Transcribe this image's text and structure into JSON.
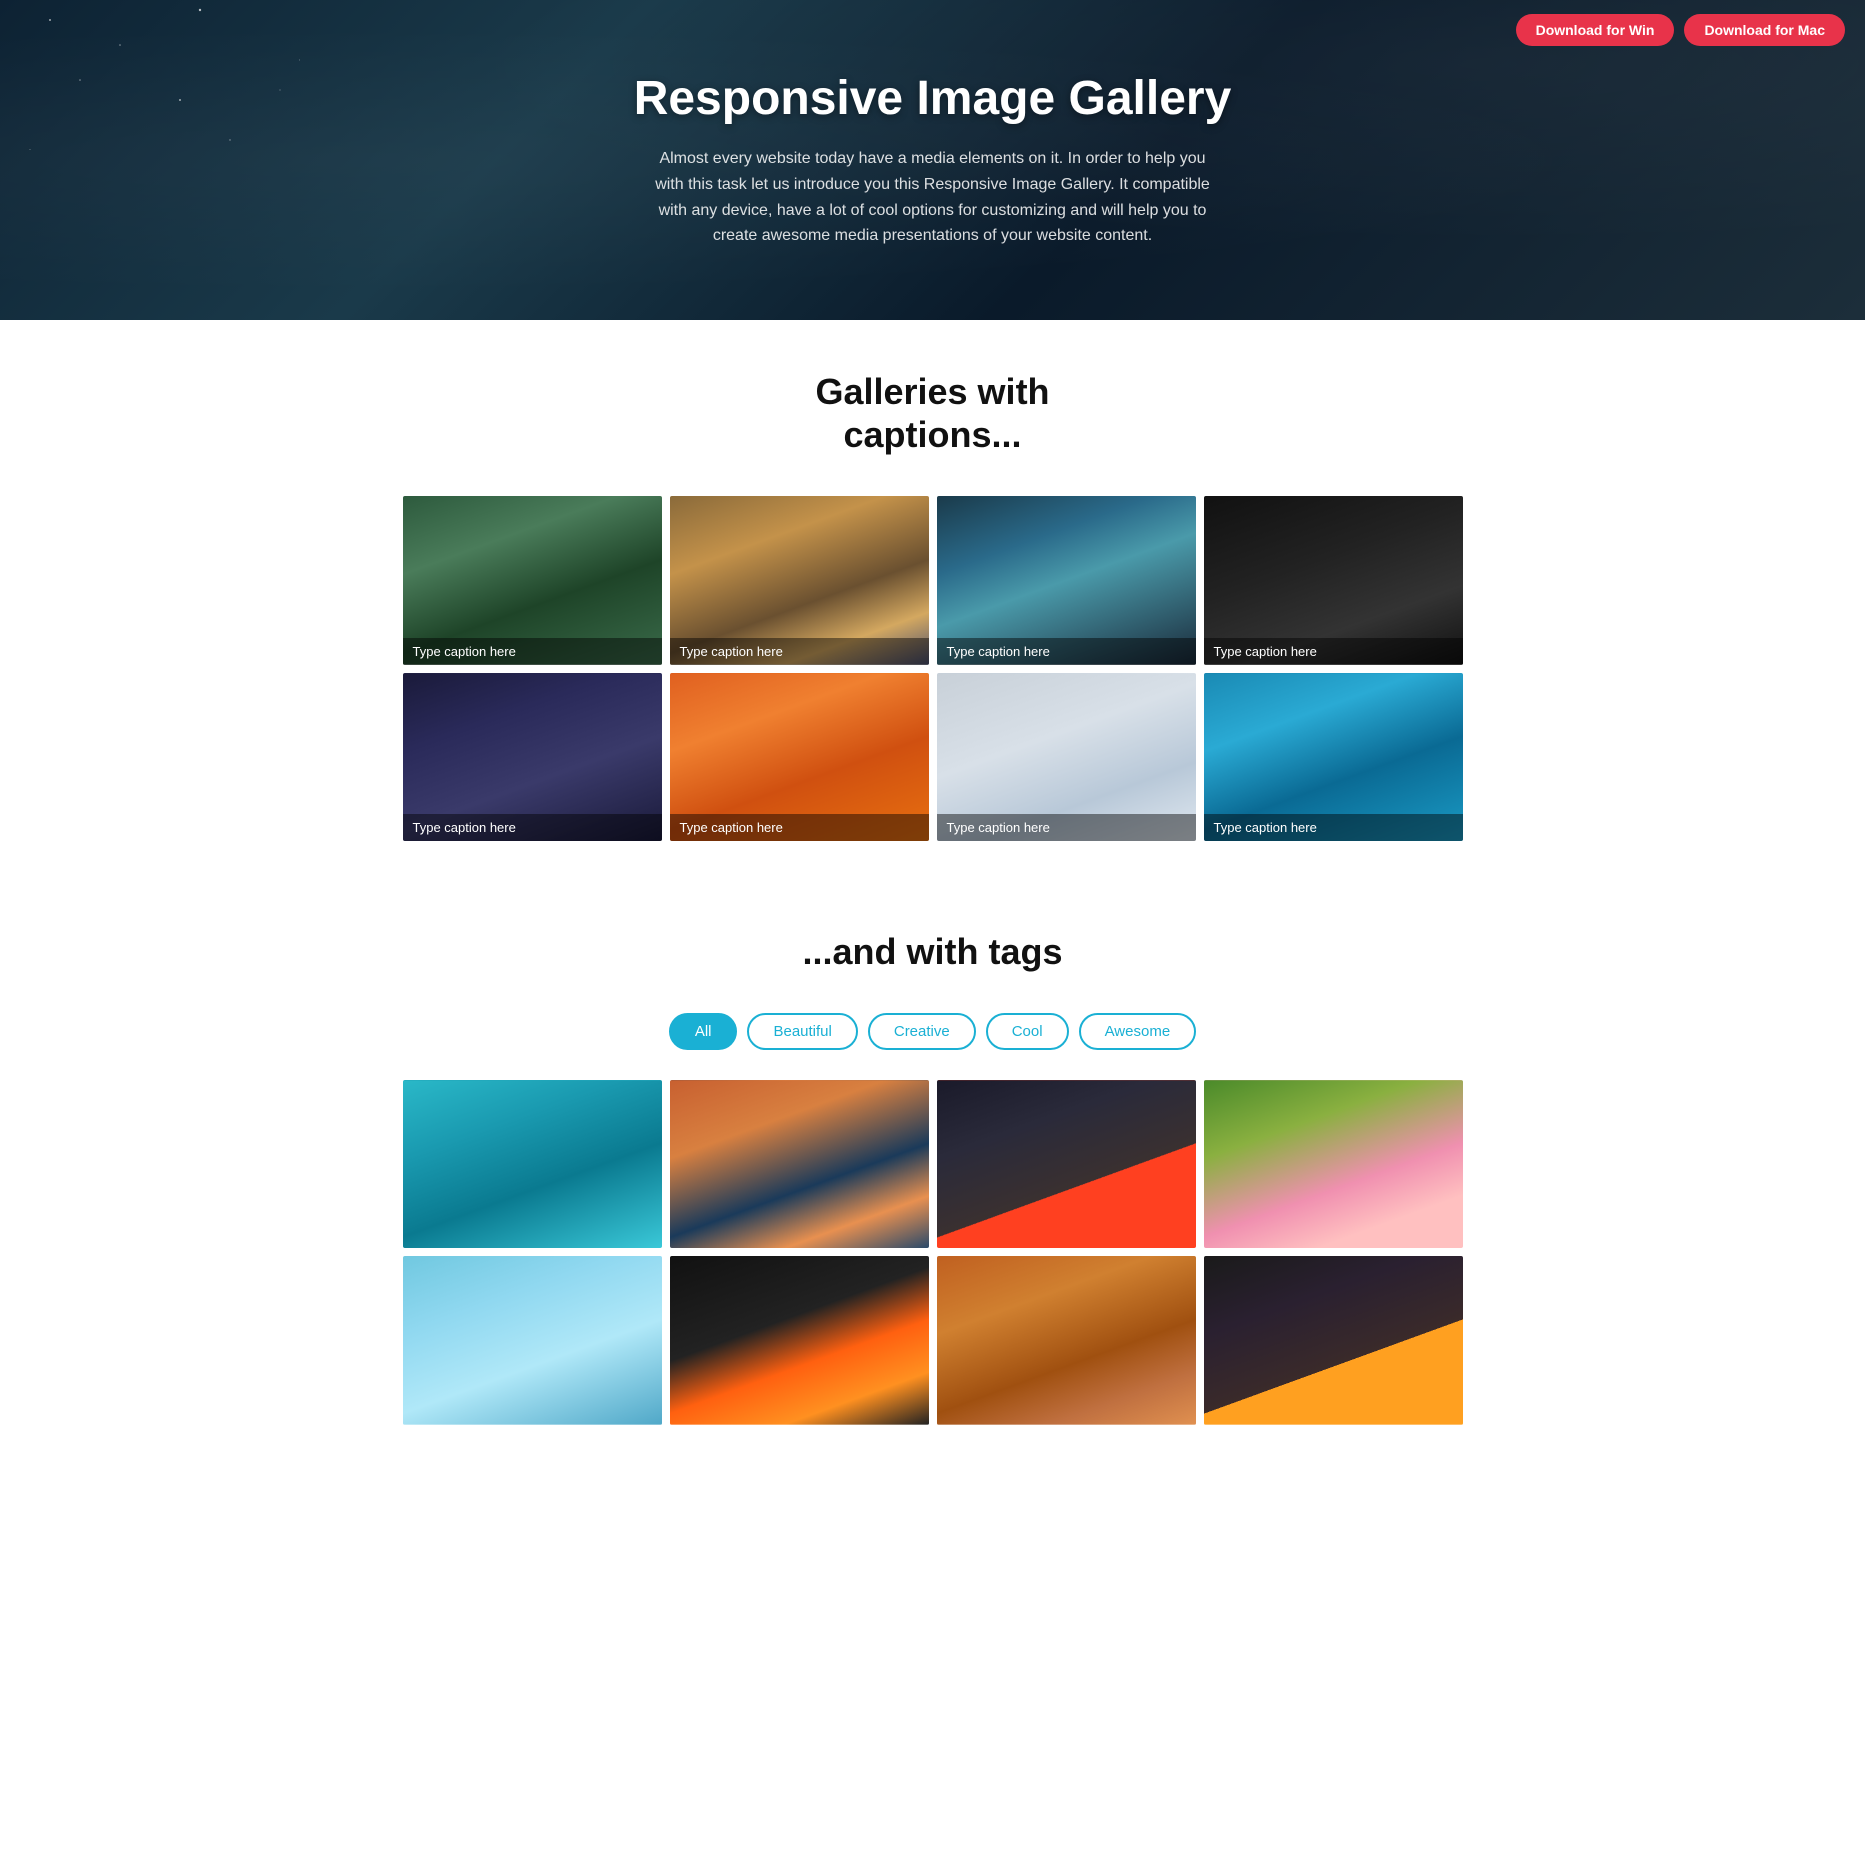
{
  "header": {
    "title": "Responsive Image Gallery",
    "description": "Almost every website today have a media elements on it. In order to help you with this task let us introduce you this Responsive Image Gallery. It compatible with any device, have a lot of cool options for customizing and will help you to create awesome media presentations of your website content.",
    "btn_win": "Download for Win",
    "btn_mac": "Download for Mac"
  },
  "captions_section": {
    "title": "Galleries with\ncaptions..."
  },
  "tags_section": {
    "title": "...and with tags"
  },
  "gallery_captions": [
    {
      "caption": "Type caption here",
      "img_class": "img-forest"
    },
    {
      "caption": "Type caption here",
      "img_class": "img-building"
    },
    {
      "caption": "Type caption here",
      "img_class": "img-peacock"
    },
    {
      "caption": "Type caption here",
      "img_class": "img-dock"
    },
    {
      "caption": "Type caption here",
      "img_class": "img-cabin"
    },
    {
      "caption": "Type caption here",
      "img_class": "img-fruits"
    },
    {
      "caption": "Type caption here",
      "img_class": "img-snow"
    },
    {
      "caption": "Type caption here",
      "img_class": "img-city"
    }
  ],
  "tag_filters": [
    {
      "label": "All",
      "active": true
    },
    {
      "label": "Beautiful",
      "active": false
    },
    {
      "label": "Creative",
      "active": false
    },
    {
      "label": "Cool",
      "active": false
    },
    {
      "label": "Awesome",
      "active": false
    }
  ],
  "gallery_tags": [
    {
      "img_class": "img-lake-turq"
    },
    {
      "img_class": "img-mountains"
    },
    {
      "img_class": "img-dark-city"
    },
    {
      "img_class": "img-cherry"
    },
    {
      "img_class": "img-pier"
    },
    {
      "img_class": "img-fire"
    },
    {
      "img_class": "img-bokeh"
    },
    {
      "img_class": "img-rock"
    }
  ]
}
